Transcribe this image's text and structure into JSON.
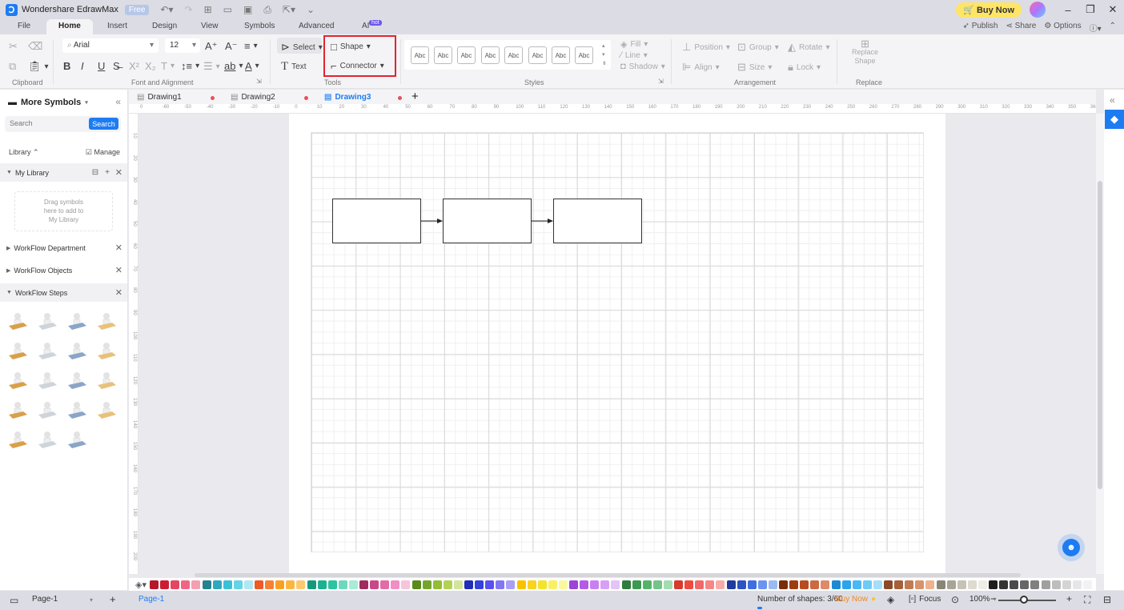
{
  "app": {
    "title": "Wondershare EdrawMax",
    "plan_badge": "Free",
    "buy_now": "Buy Now"
  },
  "menu": {
    "tabs": [
      {
        "label": "File",
        "active": false
      },
      {
        "label": "Home",
        "active": true
      },
      {
        "label": "Insert",
        "active": false
      },
      {
        "label": "Design",
        "active": false
      },
      {
        "label": "View",
        "active": false
      },
      {
        "label": "Symbols",
        "active": false
      },
      {
        "label": "Advanced",
        "active": false
      },
      {
        "label": "AI",
        "active": false,
        "badge": "hot"
      }
    ],
    "right": {
      "publish": "Publish",
      "share": "Share",
      "options": "Options",
      "help": "?"
    }
  },
  "ribbon": {
    "clipboard": {
      "label": "Clipboard"
    },
    "font": {
      "family": "Arial",
      "size": "12",
      "label": "Font and Alignment"
    },
    "tools": {
      "select": "Select",
      "text": "Text",
      "shape": "Shape",
      "connector": "Connector",
      "label": "Tools"
    },
    "styles": {
      "swatch_label": "Abc",
      "fill": "Fill",
      "line": "Line",
      "shadow": "Shadow",
      "label": "Styles"
    },
    "arrangement": {
      "position": "Position",
      "group": "Group",
      "rotate": "Rotate",
      "align": "Align",
      "size": "Size",
      "lock": "Lock",
      "label": "Arrangement"
    },
    "replace": {
      "button_line1": "Replace",
      "button_line2": "Shape",
      "label": "Replace"
    }
  },
  "left_panel": {
    "title": "More Symbols",
    "search_placeholder": "Search",
    "search_button": "Search",
    "library_label": "Library",
    "manage_label": "Manage",
    "my_library": "My Library",
    "drop_hint_1": "Drag symbols",
    "drop_hint_2": "here to add to",
    "drop_hint_3": "My Library",
    "sections": [
      {
        "label": "WorkFlow Department",
        "open": false
      },
      {
        "label": "WorkFlow Objects",
        "open": false
      },
      {
        "label": "WorkFlow Steps",
        "open": true
      }
    ],
    "symbols": [
      "worker-at-desk",
      "worker-at-desk-red",
      "documents-stack",
      "worker-desk-laptop",
      "worker-desk-dark",
      "org-chart",
      "two-workers-desk",
      "standing-worker",
      "search-report",
      "worker-desk-papers",
      "worker-desk-writing",
      "laptop-clock",
      "monitor-presentation",
      "stopwatch-checklist",
      "worker-desk-notes",
      "worker-desk-chair",
      "presenter-board",
      "phone-call",
      "handshake"
    ]
  },
  "doc_tabs": [
    {
      "label": "Drawing1",
      "active": false,
      "unsaved": true
    },
    {
      "label": "Drawing2",
      "active": false,
      "unsaved": true
    },
    {
      "label": "Drawing3",
      "active": true,
      "unsaved": true
    }
  ],
  "rulers": {
    "horizontal": [
      "0",
      "-60",
      "-50",
      "-40",
      "-30",
      "-20",
      "-10",
      "0",
      "10",
      "20",
      "30",
      "40",
      "50",
      "60",
      "70",
      "80",
      "90",
      "100",
      "110",
      "120",
      "130",
      "140",
      "150",
      "160",
      "170",
      "180",
      "190",
      "200",
      "210",
      "220",
      "230",
      "240",
      "250",
      "260",
      "270",
      "280",
      "290",
      "300",
      "310",
      "320",
      "330",
      "340",
      "350",
      "360"
    ],
    "vertical": [
      "10",
      "20",
      "30",
      "40",
      "50",
      "60",
      "70",
      "80",
      "90",
      "100",
      "110",
      "120",
      "130",
      "140",
      "150",
      "160",
      "170",
      "180",
      "190",
      "200"
    ]
  },
  "diagram": {
    "shapes": [
      "rectangle-1",
      "rectangle-2",
      "rectangle-3"
    ],
    "connectors": [
      {
        "from": "rectangle-1",
        "to": "rectangle-2"
      },
      {
        "from": "rectangle-2",
        "to": "rectangle-3"
      }
    ]
  },
  "palette": [
    "#b5172b",
    "#cc1c32",
    "#e64560",
    "#f06584",
    "#f4a0b2",
    "#26828e",
    "#2fa8bd",
    "#3bc0d8",
    "#66d3e6",
    "#aee8f2",
    "#f05a24",
    "#f78132",
    "#f9a023",
    "#fbb640",
    "#fcc970",
    "#17977c",
    "#1cb18f",
    "#2bc49f",
    "#6dd8bd",
    "#a8ebd8",
    "#9e2a5e",
    "#c94887",
    "#e26ca5",
    "#f18ec4",
    "#f7c4dd",
    "#5a8a1a",
    "#74a52a",
    "#93bd33",
    "#b3d255",
    "#d3e59a",
    "#1f2db8",
    "#3242dc",
    "#5a4ff0",
    "#8177f4",
    "#a99ff7",
    "#f8c200",
    "#fad21f",
    "#f3e32c",
    "#f8f062",
    "#fbf8a0",
    "#9b44d6",
    "#b45ae8",
    "#c97ff2",
    "#d6a0f5",
    "#e4c3f8",
    "#2e7d3e",
    "#3b9a4f",
    "#54b36a",
    "#74c48a",
    "#a3dcb0",
    "#d83a2e",
    "#ef4a3f",
    "#f2686a",
    "#f58786",
    "#f8aca8",
    "#203a9e",
    "#2d52c2",
    "#3f6ee0",
    "#6a94ee",
    "#9bbaf4",
    "#7b2e0c",
    "#9e3c10",
    "#b84c1e",
    "#cc6a40",
    "#de8a6a",
    "#1a8ad4",
    "#2ba4ec",
    "#49b8f3",
    "#6fcaf6",
    "#a5def9",
    "#8a4a2a",
    "#a65f3a",
    "#c17a52",
    "#d8926c",
    "#eeb28e",
    "#8a8677",
    "#a8a496",
    "#c5c2b6",
    "#dddbd0",
    "#eeede6",
    "#1e1e1e",
    "#333333",
    "#4a4a4a",
    "#666666",
    "#808080",
    "#a0a0a0",
    "#bdbdbd",
    "#d4d4d4",
    "#e6e6e6",
    "#f2f2f2"
  ],
  "status": {
    "page_selector": "Page-1",
    "page_tab": "Page-1",
    "shape_count": "Number of shapes: 3/60",
    "buy_now": "Buy Now",
    "focus": "Focus",
    "zoom": "100%",
    "zoom_level_percent": 100
  }
}
